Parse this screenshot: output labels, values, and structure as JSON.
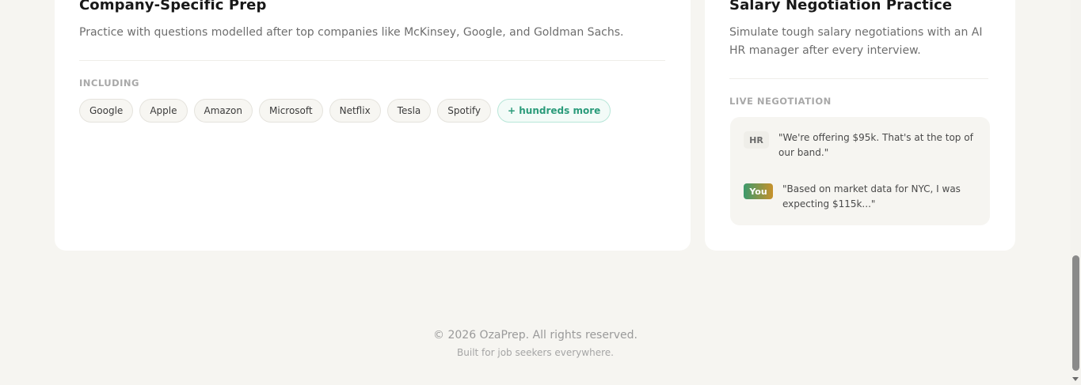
{
  "company_card": {
    "title": "Company-Specific Prep",
    "description": "Practice with questions modelled after top companies like McKinsey, Google, and Goldman Sachs.",
    "section_label": "INCLUDING",
    "chips": [
      "Google",
      "Apple",
      "Amazon",
      "Microsoft",
      "Netflix",
      "Tesla",
      "Spotify"
    ],
    "more_chip": "+ hundreds more"
  },
  "salary_card": {
    "title": "Salary Negotiation Practice",
    "description": "Simulate tough salary negotiations with an AI HR manager after every interview.",
    "section_label": "LIVE NEGOTIATION",
    "messages": [
      {
        "speaker": "HR",
        "text": "\"We're offering $95k. That's at the top of our band.\""
      },
      {
        "speaker": "You",
        "text": "\"Based on market data for NYC, I was expecting $115k...\""
      }
    ]
  },
  "footer": {
    "copyright": "© 2026 OzaPrep. All rights reserved.",
    "tagline": "Built for job seekers everywhere."
  }
}
